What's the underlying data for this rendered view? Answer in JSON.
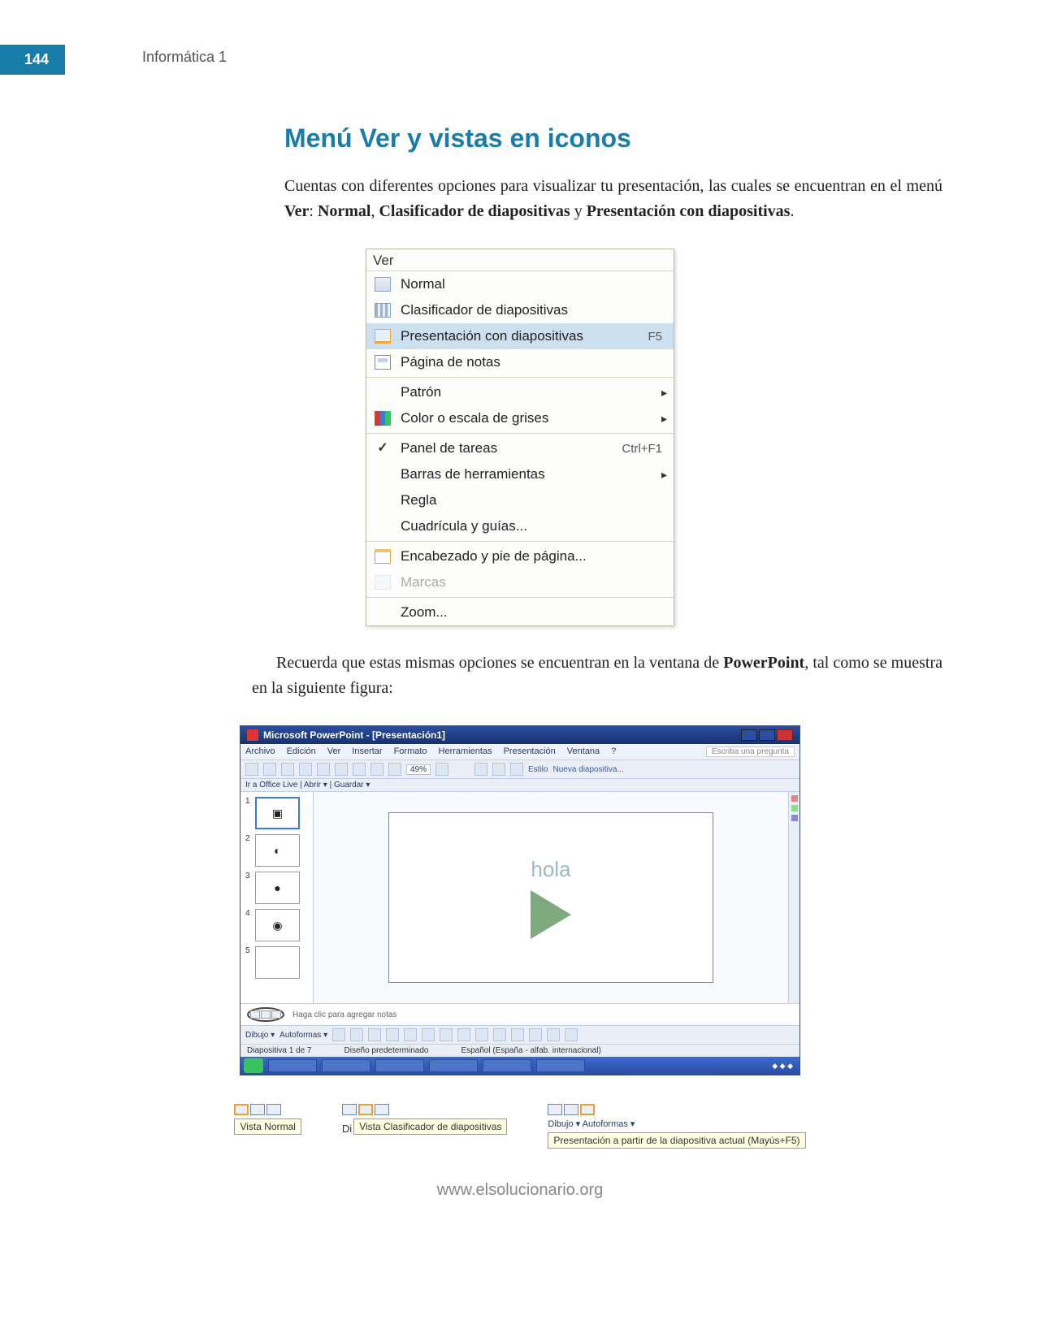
{
  "page_number": "144",
  "book_title": "Informática 1",
  "heading": "Menú Ver y vistas en iconos",
  "intro_html": "Cuentas con diferentes opciones para visualizar tu presentación, las cuales se encuentran en el menú <b>Ver</b>: <b>Normal</b>, <b>Clasificador de diapositivas</b> y <b>Presentación con diapositivas</b>.",
  "ver_menu": {
    "title": "Ver",
    "items": [
      {
        "label": "Normal",
        "icon": "ic-normal"
      },
      {
        "label": "Clasificador de diapositivas",
        "icon": "ic-grid"
      },
      {
        "label": "Presentación con diapositivas",
        "icon": "ic-present",
        "shortcut": "F5",
        "selected": true
      },
      {
        "label": "Página de notas",
        "icon": "ic-notes"
      },
      {
        "sep": true
      },
      {
        "label": "Patrón",
        "submenu": true
      },
      {
        "label": "Color o escala de grises",
        "icon": "ic-color",
        "submenu": true
      },
      {
        "sep": true
      },
      {
        "label": "Panel de tareas",
        "icon": "ic-check",
        "check": true,
        "shortcut": "Ctrl+F1"
      },
      {
        "label": "Barras de herramientas",
        "submenu": true
      },
      {
        "label": "Regla"
      },
      {
        "label": "Cuadrícula y guías..."
      },
      {
        "sep": true
      },
      {
        "label": "Encabezado y pie de página...",
        "icon": "ic-header"
      },
      {
        "label": "Marcas",
        "icon": "ic-marcas",
        "disabled": true
      },
      {
        "sep": true
      },
      {
        "label": "Zoom..."
      }
    ]
  },
  "mid_para_html": "Recuerda que estas mismas opciones se encuentran en la ventana de <b>PowerPoint</b>, tal como se muestra en la siguiente figura:",
  "pp": {
    "title": "Microsoft PowerPoint - [Presentación1]",
    "ask_box": "Escriba una pregunta",
    "menubar": [
      "Archivo",
      "Edición",
      "Ver",
      "Insertar",
      "Formato",
      "Herramientas",
      "Presentación",
      "Ventana",
      "?"
    ],
    "toolbar_zoom": "49%",
    "toolbar_est": "Estilo",
    "toolbar_nd": "Nueva diapositiva...",
    "outline_tabs": "Ir a Office Live | Abrir ▾ | Guardar ▾",
    "thumbs": [
      "1",
      "2",
      "3",
      "4",
      "5"
    ],
    "slide_text": "hola",
    "notes_placeholder": "Haga clic para agregar notas",
    "draw_label": "Dibujo ▾",
    "autoshapes": "Autoformas ▾",
    "status_slide": "Diapositiva 1 de 7",
    "status_design": "Diseño predeterminado",
    "status_lang": "Español (España - alfab. internacional)"
  },
  "callouts": {
    "c1": "Vista Normal",
    "c2_prefix": "Di",
    "c2": "Vista Clasificador de diapositivas",
    "c3_line1": "Dibujo ▾      Autoformas ▾",
    "c3_tip": "Presentación a partir de la diapositiva actual (Mayús+F5)"
  },
  "footer": "www.elsolucionario.org"
}
